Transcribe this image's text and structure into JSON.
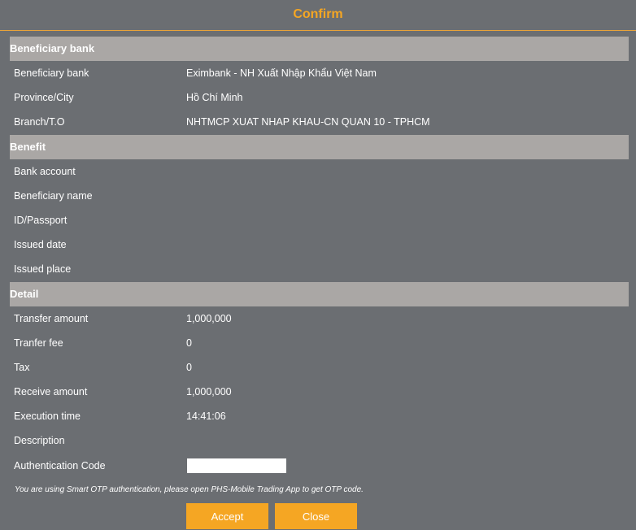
{
  "dialog": {
    "title": "Confirm"
  },
  "sections": {
    "beneficiary_bank": {
      "header": "Beneficiary bank",
      "rows": [
        {
          "label": "Beneficiary bank",
          "value": "Eximbank - NH Xuất Nhập Khẩu Việt Nam"
        },
        {
          "label": "Province/City",
          "value": "Hồ Chí Minh"
        },
        {
          "label": "Branch/T.O",
          "value": "NHTMCP XUAT NHAP KHAU-CN QUAN 10 - TPHCM"
        }
      ]
    },
    "benefit": {
      "header": "Benefit",
      "rows": [
        {
          "label": "Bank account",
          "value": ""
        },
        {
          "label": "Beneficiary name",
          "value": ""
        },
        {
          "label": "ID/Passport",
          "value": ""
        },
        {
          "label": "Issued date",
          "value": ""
        },
        {
          "label": "Issued place",
          "value": ""
        }
      ]
    },
    "detail": {
      "header": "Detail",
      "rows": [
        {
          "label": "Transfer amount",
          "value": "1,000,000"
        },
        {
          "label": "Tranfer fee",
          "value": "0"
        },
        {
          "label": "Tax",
          "value": "0"
        },
        {
          "label": "Receive amount",
          "value": "1,000,000"
        },
        {
          "label": "Execution time",
          "value": "14:41:06"
        },
        {
          "label": "Description",
          "value": ""
        }
      ],
      "auth": {
        "label": "Authentication Code",
        "value": "",
        "placeholder": ""
      }
    }
  },
  "otp_note": "You are using Smart OTP authentication, please open PHS-Mobile Trading App to get OTP code.",
  "buttons": {
    "accept": "Accept",
    "close": "Close"
  },
  "colors": {
    "background": "#6b6e72",
    "section_header": "#aaa7a5",
    "accent": "#f5a623"
  }
}
